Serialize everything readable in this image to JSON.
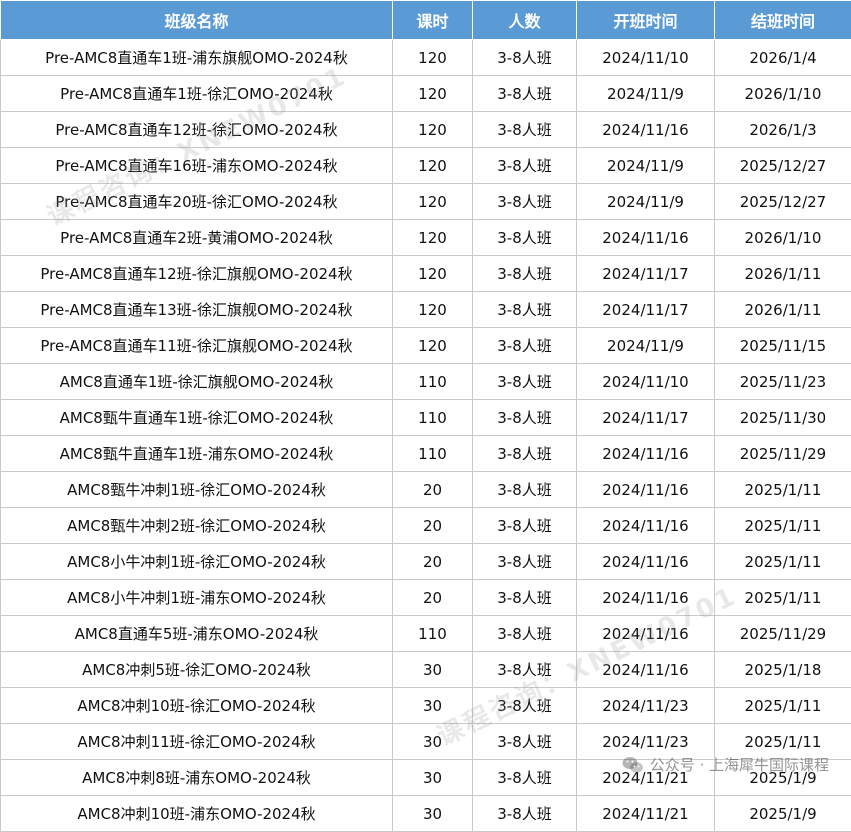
{
  "table": {
    "headers": [
      "班级名称",
      "课时",
      "人数",
      "开班时间",
      "结班时间"
    ],
    "rows": [
      [
        "Pre-AMC8直通车1班-浦东旗舰OMO-2024秋",
        "120",
        "3-8人班",
        "2024/11/10",
        "2026/1/4"
      ],
      [
        "Pre-AMC8直通车1班-徐汇OMO-2024秋",
        "120",
        "3-8人班",
        "2024/11/9",
        "2026/1/10"
      ],
      [
        "Pre-AMC8直通车12班-徐汇OMO-2024秋",
        "120",
        "3-8人班",
        "2024/11/16",
        "2026/1/3"
      ],
      [
        "Pre-AMC8直通车16班-浦东OMO-2024秋",
        "120",
        "3-8人班",
        "2024/11/9",
        "2025/12/27"
      ],
      [
        "Pre-AMC8直通车20班-徐汇OMO-2024秋",
        "120",
        "3-8人班",
        "2024/11/9",
        "2025/12/27"
      ],
      [
        "Pre-AMC8直通车2班-黄浦OMO-2024秋",
        "120",
        "3-8人班",
        "2024/11/16",
        "2026/1/10"
      ],
      [
        "Pre-AMC8直通车12班-徐汇旗舰OMO-2024秋",
        "120",
        "3-8人班",
        "2024/11/17",
        "2026/1/11"
      ],
      [
        "Pre-AMC8直通车13班-徐汇旗舰OMO-2024秋",
        "120",
        "3-8人班",
        "2024/11/17",
        "2026/1/11"
      ],
      [
        "Pre-AMC8直通车11班-徐汇旗舰OMO-2024秋",
        "120",
        "3-8人班",
        "2024/11/9",
        "2025/11/15"
      ],
      [
        "AMC8直通车1班-徐汇旗舰OMO-2024秋",
        "110",
        "3-8人班",
        "2024/11/10",
        "2025/11/23"
      ],
      [
        "AMC8甄牛直通车1班-徐汇OMO-2024秋",
        "110",
        "3-8人班",
        "2024/11/17",
        "2025/11/30"
      ],
      [
        "AMC8甄牛直通车1班-浦东OMO-2024秋",
        "110",
        "3-8人班",
        "2024/11/16",
        "2025/11/29"
      ],
      [
        "AMC8甄牛冲刺1班-徐汇OMO-2024秋",
        "20",
        "3-8人班",
        "2024/11/16",
        "2025/1/11"
      ],
      [
        "AMC8甄牛冲刺2班-徐汇OMO-2024秋",
        "20",
        "3-8人班",
        "2024/11/16",
        "2025/1/11"
      ],
      [
        "AMC8小牛冲刺1班-徐汇OMO-2024秋",
        "20",
        "3-8人班",
        "2024/11/16",
        "2025/1/11"
      ],
      [
        "AMC8小牛冲刺1班-浦东OMO-2024秋",
        "20",
        "3-8人班",
        "2024/11/16",
        "2025/1/11"
      ],
      [
        "AMC8直通车5班-浦东OMO-2024秋",
        "110",
        "3-8人班",
        "2024/11/16",
        "2025/11/29"
      ],
      [
        "AMC8冲刺5班-徐汇OMO-2024秋",
        "30",
        "3-8人班",
        "2024/11/16",
        "2025/1/18"
      ],
      [
        "AMC8冲刺10班-徐汇OMO-2024秋",
        "30",
        "3-8人班",
        "2024/11/23",
        "2025/1/11"
      ],
      [
        "AMC8冲刺11班-徐汇OMO-2024秋",
        "30",
        "3-8人班",
        "2024/11/23",
        "2025/1/11"
      ],
      [
        "AMC8冲刺8班-浦东OMO-2024秋",
        "30",
        "3-8人班",
        "2024/11/21",
        "2025/1/9"
      ],
      [
        "AMC8冲刺10班-浦东OMO-2024秋",
        "30",
        "3-8人班",
        "2024/11/21",
        "2025/1/9"
      ]
    ]
  },
  "watermark": {
    "text": "课程咨询：XNEW0701"
  },
  "credit": {
    "text": "公众号 · 上海犀牛国际课程",
    "icon": "wechat-icon"
  },
  "colors": {
    "header_bg": "#5b9bd5",
    "header_text": "#ffffff",
    "border": "#c9c9c9"
  }
}
